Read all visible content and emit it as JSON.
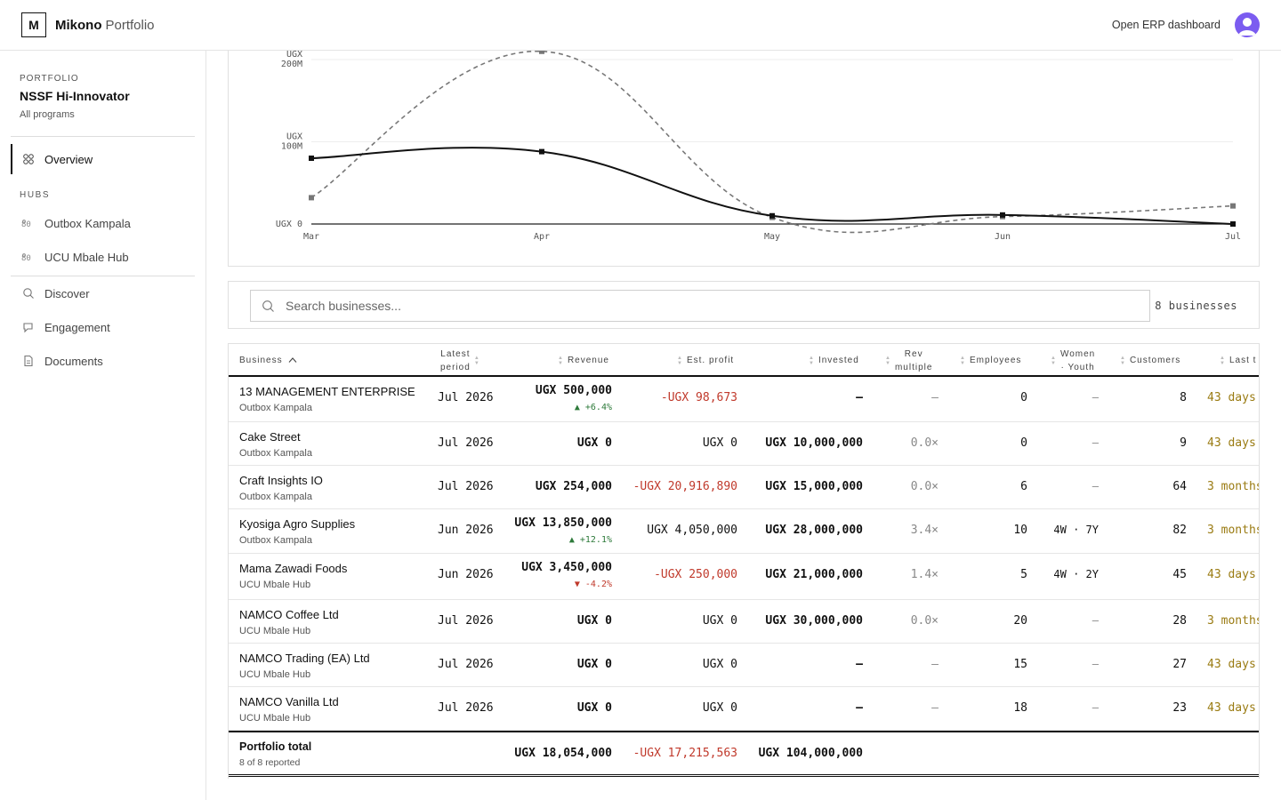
{
  "header": {
    "logo_letter": "M",
    "brand_name": "Mikono",
    "brand_section": "Portfolio",
    "erp_link": "Open ERP dashboard"
  },
  "sidebar": {
    "kicker": "PORTFOLIO",
    "portfolio_name": "NSSF Hi-Innovator",
    "portfolio_sub": "All programs",
    "overview": "Overview",
    "hubs_label": "HUBS",
    "hubs": [
      "Outbox Kampala",
      "UCU Mbale Hub"
    ],
    "nav": [
      "Discover",
      "Engagement",
      "Documents"
    ]
  },
  "chart_data": {
    "type": "line",
    "x": [
      "Mar",
      "Apr",
      "May",
      "Jun",
      "Jul"
    ],
    "series": [
      {
        "values": [
          80,
          88,
          10,
          11,
          0
        ],
        "style": "solid",
        "color": "#111111"
      },
      {
        "values": [
          32,
          210,
          8,
          9,
          22
        ],
        "style": "dashed",
        "color": "#777777"
      }
    ],
    "ylim": [
      0,
      210
    ],
    "yticks": [
      {
        "value": 0,
        "label_line1": "",
        "label_line2": "UGX 0"
      },
      {
        "value": 100,
        "label_line1": "UGX",
        "label_line2": "100M"
      },
      {
        "value": 200,
        "label_line1": "UGX",
        "label_line2": "200M"
      }
    ],
    "grid": true
  },
  "search": {
    "placeholder": "Search businesses...",
    "count": "8 businesses"
  },
  "table": {
    "headers": {
      "business": "Business",
      "latest_1": "Latest",
      "latest_2": "period",
      "revenue": "Revenue",
      "profit": "Est. profit",
      "invested": "Invested",
      "rev_1": "Rev",
      "rev_2": "multiple",
      "employees": "Employees",
      "women_1": "Women",
      "women_2": "· Youth",
      "customers": "Customers",
      "last": "Last t"
    },
    "rows": [
      {
        "name": "13 MANAGEMENT ENTERPRISE",
        "hub": "Outbox Kampala",
        "period": "Jul 2026",
        "revenue": "UGX 500,000",
        "delta": "▲ +6.4%",
        "delta_dir": "up",
        "profit": "-UGX 98,673",
        "profit_neg": true,
        "invested": "—",
        "multiple": "—",
        "employees": "0",
        "wy": "—",
        "customers": "8",
        "last": "43 days"
      },
      {
        "name": "Cake Street",
        "hub": "Outbox Kampala",
        "period": "Jul 2026",
        "revenue": "UGX 0",
        "delta": "",
        "delta_dir": "",
        "profit": "UGX 0",
        "profit_neg": false,
        "invested": "UGX 10,000,000",
        "multiple": "0.0×",
        "employees": "0",
        "wy": "—",
        "customers": "9",
        "last": "43 days"
      },
      {
        "name": "Craft Insights IO",
        "hub": "Outbox Kampala",
        "period": "Jul 2026",
        "revenue": "UGX 254,000",
        "delta": "",
        "delta_dir": "",
        "profit": "-UGX 20,916,890",
        "profit_neg": true,
        "invested": "UGX 15,000,000",
        "multiple": "0.0×",
        "employees": "6",
        "wy": "—",
        "customers": "64",
        "last": "3 months"
      },
      {
        "name": "Kyosiga Agro Supplies",
        "hub": "Outbox Kampala",
        "period": "Jun 2026",
        "revenue": "UGX 13,850,000",
        "delta": "▲ +12.1%",
        "delta_dir": "up",
        "profit": "UGX 4,050,000",
        "profit_neg": false,
        "invested": "UGX 28,000,000",
        "multiple": "3.4×",
        "employees": "10",
        "wy": "4W · 7Y",
        "customers": "82",
        "last": "3 months"
      },
      {
        "name": "Mama Zawadi Foods",
        "hub": "UCU Mbale Hub",
        "period": "Jun 2026",
        "revenue": "UGX 3,450,000",
        "delta": "▼ -4.2%",
        "delta_dir": "down",
        "profit": "-UGX 250,000",
        "profit_neg": true,
        "invested": "UGX 21,000,000",
        "multiple": "1.4×",
        "employees": "5",
        "wy": "4W · 2Y",
        "customers": "45",
        "last": "43 days"
      },
      {
        "name": "NAMCO Coffee Ltd",
        "hub": "UCU Mbale Hub",
        "period": "Jul 2026",
        "revenue": "UGX 0",
        "delta": "",
        "delta_dir": "",
        "profit": "UGX 0",
        "profit_neg": false,
        "invested": "UGX 30,000,000",
        "multiple": "0.0×",
        "employees": "20",
        "wy": "—",
        "customers": "28",
        "last": "3 months"
      },
      {
        "name": "NAMCO Trading (EA) Ltd",
        "hub": "UCU Mbale Hub",
        "period": "Jul 2026",
        "revenue": "UGX 0",
        "delta": "",
        "delta_dir": "",
        "profit": "UGX 0",
        "profit_neg": false,
        "invested": "—",
        "multiple": "—",
        "employees": "15",
        "wy": "—",
        "customers": "27",
        "last": "43 days"
      },
      {
        "name": "NAMCO Vanilla Ltd",
        "hub": "UCU Mbale Hub",
        "period": "Jul 2026",
        "revenue": "UGX 0",
        "delta": "",
        "delta_dir": "",
        "profit": "UGX 0",
        "profit_neg": false,
        "invested": "—",
        "multiple": "—",
        "employees": "18",
        "wy": "—",
        "customers": "23",
        "last": "43 days"
      }
    ],
    "total": {
      "label": "Portfolio total",
      "sub": "8 of 8 reported",
      "revenue": "UGX 18,054,000",
      "profit": "-UGX 17,215,563",
      "invested": "UGX 104,000,000"
    }
  },
  "colors": {
    "negative": "#c0392b",
    "positive": "#2d7a3a",
    "stale": "#9a7b12",
    "avatar": "#7b5cf0"
  }
}
